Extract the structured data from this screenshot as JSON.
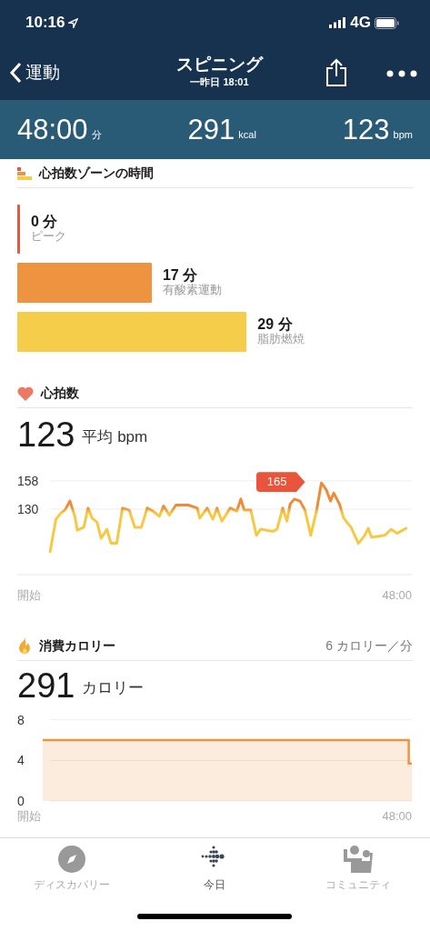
{
  "status_bar": {
    "time": "10:16",
    "network": "4G"
  },
  "nav": {
    "back_label": "運動",
    "title": "スピニング",
    "subtitle": "一昨日 18:01"
  },
  "stats": [
    {
      "value": "48:00",
      "unit": "分"
    },
    {
      "value": "291",
      "unit": "kcal"
    },
    {
      "value": "123",
      "unit": "bpm"
    }
  ],
  "zones": {
    "title": "心拍数ゾーンの時間",
    "items": [
      {
        "minutes": "0 分",
        "name": "ピーク",
        "color": "#e8573f"
      },
      {
        "minutes": "17 分",
        "name": "有酸素運動",
        "color": "#ee9440"
      },
      {
        "minutes": "29 分",
        "name": "脂肪燃焼",
        "color": "#f6cc4b"
      }
    ]
  },
  "heart_rate": {
    "title": "心拍数",
    "value": "123",
    "unit": "平均 bpm",
    "graph": {
      "kind": "line",
      "y_axis_labels": [
        "158",
        "130"
      ],
      "peak_label": "165",
      "axis_labels": [
        "開始",
        "48:00"
      ]
    }
  },
  "calories": {
    "title": "消費カロリー",
    "rate": "6 カロリー／分",
    "value": "291",
    "unit": "カロリー",
    "graph": {
      "kind": "area",
      "y_axis_labels": [
        "8",
        "4",
        "0"
      ],
      "axis_labels": [
        "開始",
        "48:00"
      ]
    }
  },
  "tab_bar": [
    {
      "kind": "compass",
      "label": "ディスカバリー",
      "selected": false
    },
    {
      "kind": "dots",
      "label": "今日",
      "selected": true
    },
    {
      "kind": "people",
      "label": "コミュニティ",
      "selected": false
    }
  ]
}
